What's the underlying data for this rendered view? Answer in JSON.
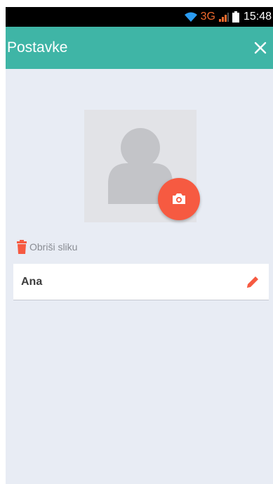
{
  "status_bar": {
    "network": "3G",
    "time": "15:48"
  },
  "appbar": {
    "title": "Postavke",
    "close_icon": "close-icon"
  },
  "profile": {
    "avatar_icon": "person-placeholder-icon",
    "camera_icon": "camera-icon",
    "delete_label": "Obriši sliku",
    "delete_icon": "trash-icon",
    "name_value": "Ana",
    "edit_icon": "pencil-icon"
  },
  "colors": {
    "appbar": "#3fb5a6",
    "accent": "#f65a41",
    "background": "#e8ecf4",
    "network_text": "#f06a2d"
  }
}
